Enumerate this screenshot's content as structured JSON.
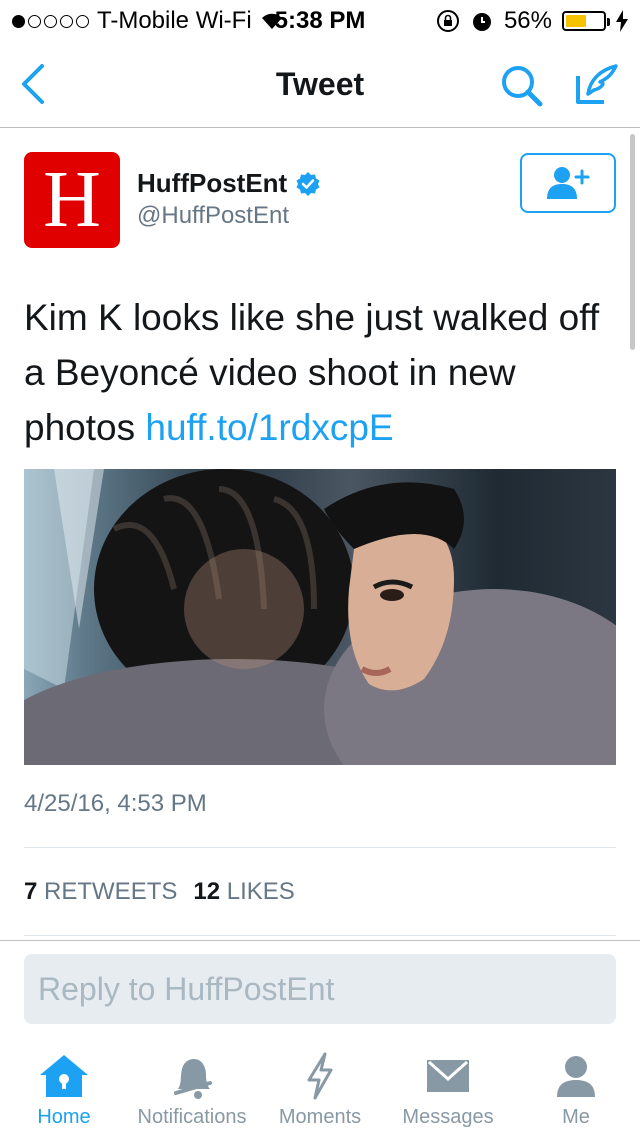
{
  "status_bar": {
    "carrier": "T-Mobile Wi-Fi",
    "time": "5:38 PM",
    "battery": "56%",
    "battery_level": 0.56,
    "signal_bars_filled": 1,
    "signal_bars_total": 5
  },
  "nav": {
    "title": "Tweet",
    "icons": [
      "back-chevron-icon",
      "search-icon",
      "compose-icon"
    ]
  },
  "tweet": {
    "avatar_letter": "H",
    "display_name": "HuffPostEnt",
    "handle": "@HuffPostEnt",
    "text": "Kim K looks like she just walked off a Beyoncé video shoot in new photos",
    "link": "huff.to/1rdxcpE",
    "timestamp": "4/25/16, 4:53 PM",
    "retweets_count": "7",
    "retweets_label": "RETWEETS",
    "likes_count": "12",
    "likes_label": "LIKES"
  },
  "reply": {
    "placeholder": "Reply to HuffPostEnt"
  },
  "tabbar": {
    "items": [
      {
        "label": "Home",
        "icon": "home-icon",
        "active": true
      },
      {
        "label": "Notifications",
        "icon": "bell-icon",
        "active": false
      },
      {
        "label": "Moments",
        "icon": "lightning-icon",
        "active": false
      },
      {
        "label": "Messages",
        "icon": "envelope-icon",
        "active": false
      },
      {
        "label": "Me",
        "icon": "person-icon",
        "active": false
      }
    ]
  },
  "colors": {
    "accent": "#1da1f2",
    "text": "#14171a",
    "secondary": "#657786",
    "brand_red": "#e10000"
  }
}
